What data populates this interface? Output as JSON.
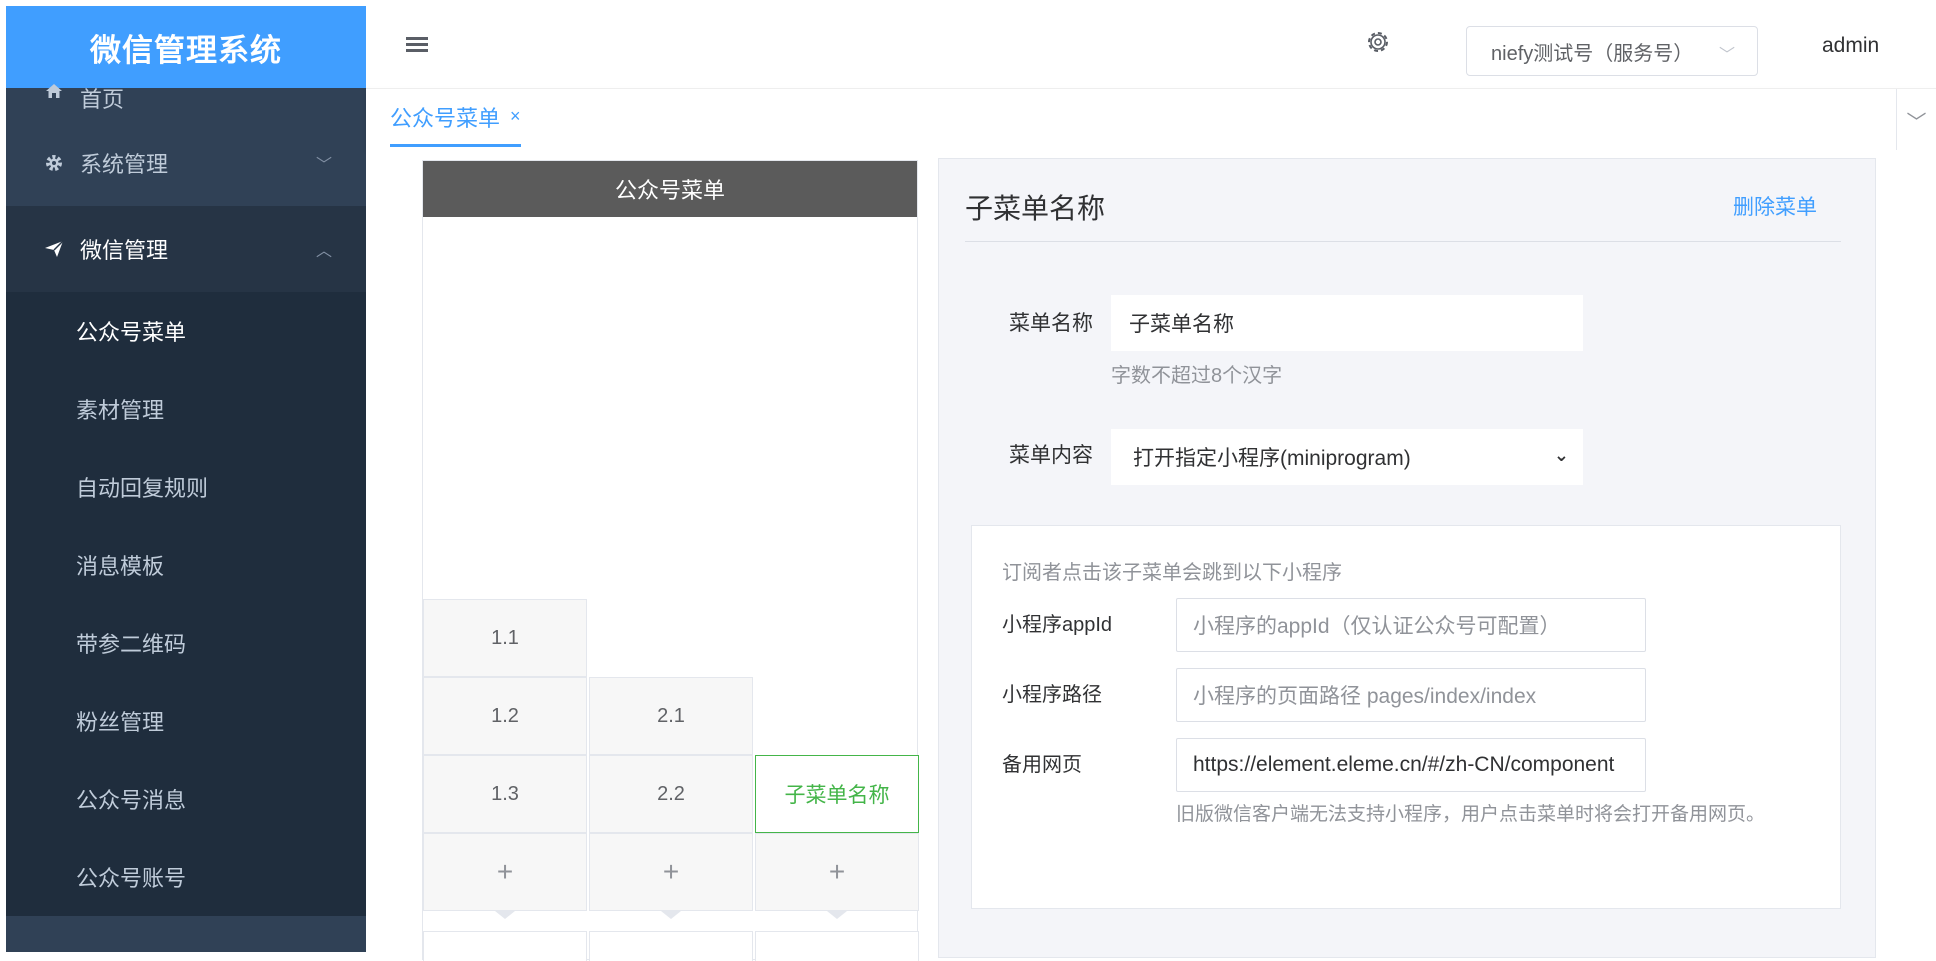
{
  "sidebar": {
    "brand": "微信管理系统",
    "home": "首页",
    "system": "系统管理",
    "wechat": "微信管理",
    "sub_items": [
      "公众号菜单",
      "素材管理",
      "自动回复规则",
      "消息模板",
      "带参二维码",
      "粉丝管理",
      "公众号消息",
      "公众号账号"
    ]
  },
  "header": {
    "account": "niefy测试号（服务号）",
    "user": "admin"
  },
  "tags": {
    "active_tag": "公众号菜单",
    "close": "×"
  },
  "phone": {
    "title": "公众号菜单",
    "col1": [
      "1.1",
      "1.2",
      "1.3"
    ],
    "col2": [
      "2.1",
      "2.2"
    ],
    "col3": [
      "子菜单名称"
    ],
    "add": "+"
  },
  "editor": {
    "title": "子菜单名称",
    "delete": "删除菜单",
    "name_label": "菜单名称",
    "name_value": "子菜单名称",
    "name_hint": "字数不超过8个汉字",
    "content_label": "菜单内容",
    "content_value": "打开指定小程序(miniprogram)",
    "mini": {
      "desc": "订阅者点击该子菜单会跳到以下小程序",
      "appid_label": "小程序appId",
      "appid_placeholder": "小程序的appId（仅认证公众号可配置）",
      "path_label": "小程序路径",
      "path_placeholder": "小程序的页面路径 pages/index/index",
      "url_label": "备用网页",
      "url_value": "https://element.eleme.cn/#/zh-CN/component",
      "tip": "旧版微信客户端无法支持小程序，用户点击菜单时将会打开备用网页。"
    }
  },
  "colors": {
    "sidebar_bg": "#304156",
    "brand_bg": "#409eff",
    "accent": "#409eff",
    "green": "#44b549"
  },
  "icons": [
    "home-icon",
    "gear-icon",
    "send-icon",
    "hamburger-icon",
    "settings-icon",
    "chevron-down-icon"
  ]
}
